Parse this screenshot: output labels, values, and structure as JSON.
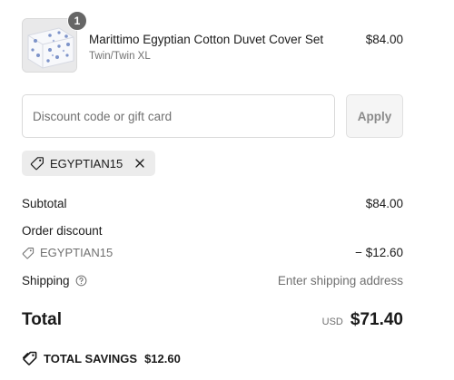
{
  "line_item": {
    "quantity": "1",
    "title": "Marittimo Egyptian Cotton Duvet Cover Set",
    "variant": "Twin/Twin XL",
    "price": "$84.00"
  },
  "discount": {
    "placeholder": "Discount code or gift card",
    "apply_label": "Apply",
    "applied_code": "EGYPTIAN15"
  },
  "summary": {
    "subtotal_label": "Subtotal",
    "subtotal_value": "$84.00",
    "order_discount_label": "Order discount",
    "order_discount_code": "EGYPTIAN15",
    "order_discount_value": "− $12.60",
    "shipping_label": "Shipping",
    "shipping_value": "Enter shipping address",
    "total_label": "Total",
    "currency": "USD",
    "total_value": "$71.40",
    "savings_label": "TOTAL SAVINGS",
    "savings_value": "$12.60"
  },
  "colors": {
    "text": "#1a1a1a",
    "muted": "#707070",
    "badge": "#666666",
    "chip_bg": "#ececec",
    "button_bg": "#f5f5f5"
  }
}
